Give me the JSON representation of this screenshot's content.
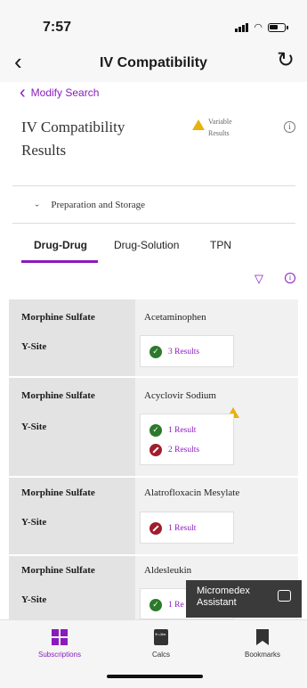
{
  "status": {
    "time": "7:57"
  },
  "nav": {
    "back": "‹",
    "title": "IV Compatibility",
    "refresh": "↻"
  },
  "modify_search": "Modify Search",
  "header": {
    "title": "IV Compatibility Results",
    "variable_results": "Variable Results",
    "info": "i"
  },
  "preparation": {
    "label": "Preparation and Storage"
  },
  "tabs": [
    {
      "label": "Drug-Drug",
      "active": true
    },
    {
      "label": "Drug-Solution",
      "active": false
    },
    {
      "label": "TPN",
      "active": false
    }
  ],
  "rows": [
    {
      "drug": "Morphine Sulfate",
      "route": "Y-Site",
      "partner": "Acetaminophen",
      "results": [
        {
          "status": "compatible",
          "text": "3 Results"
        }
      ],
      "warning": false
    },
    {
      "drug": "Morphine Sulfate",
      "route": "Y-Site",
      "partner": "Acyclovir Sodium",
      "results": [
        {
          "status": "compatible",
          "text": "1 Result"
        },
        {
          "status": "incompatible",
          "text": "2 Results"
        }
      ],
      "warning": true
    },
    {
      "drug": "Morphine Sulfate",
      "route": "Y-Site",
      "partner": "Alatrofloxacin Mesylate",
      "results": [
        {
          "status": "incompatible",
          "text": "1 Result"
        }
      ],
      "warning": false
    },
    {
      "drug": "Morphine Sulfate",
      "route": "Y-Site",
      "partner": "Aldesleukin",
      "results": [
        {
          "status": "compatible",
          "text": "1 Re"
        }
      ],
      "warning": false
    }
  ],
  "assistant": {
    "line1": "Micromedex",
    "line2": "Assistant"
  },
  "tabbar": [
    {
      "label": "Subscriptions",
      "icon": "grid-icon",
      "active": true
    },
    {
      "label": "Calcs",
      "icon": "calculator-icon",
      "active": false
    },
    {
      "label": "Bookmarks",
      "icon": "bookmark-icon",
      "active": false
    }
  ],
  "colors": {
    "accent": "#8a1bbd",
    "compatible": "#2b7a2b",
    "incompatible": "#a11d2b",
    "warning": "#e8b20e"
  }
}
